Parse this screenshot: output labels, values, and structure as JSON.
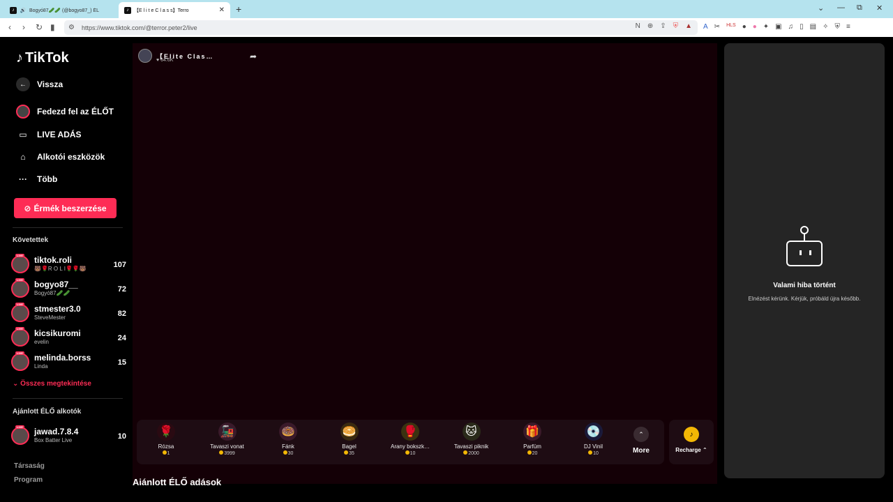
{
  "browser": {
    "tabs": [
      {
        "title": "Bogyó87🥒🥒 (@bogyo87_) ÉL",
        "active": false
      },
      {
        "title": "【E l i t e  C l a s s】Terro",
        "active": true
      }
    ],
    "url": "https://www.tiktok.com/@terror.peter2/live"
  },
  "sidebar": {
    "logo": "TikTok",
    "back": "Vissza",
    "nav": [
      {
        "label": "Fedezd fel az ÉLŐT",
        "icon": "avatar-icon"
      },
      {
        "label": "LIVE ADÁS",
        "icon": "camera-icon"
      },
      {
        "label": "Alkotói eszközök",
        "icon": "creator-tools-icon"
      },
      {
        "label": "Több",
        "icon": "more-dots-icon"
      }
    ],
    "coins_button": "Érmék beszerzése",
    "following_title": "Követettek",
    "following": [
      {
        "name": "tiktok.roli",
        "sub": "🐻🌹R O L I🌹🌹🐻",
        "count": "107"
      },
      {
        "name": "bogyo87__",
        "sub": "Bogyó87🥒🥒",
        "count": "72"
      },
      {
        "name": "stmester3.0",
        "sub": "SteveMester",
        "count": "82"
      },
      {
        "name": "kicsikuromi",
        "sub": "evelin",
        "count": "24"
      },
      {
        "name": "melinda.borss",
        "sub": "Linda",
        "count": "15"
      }
    ],
    "see_all": "Összes megtekintése",
    "recommended_title": "Ajánlott ÉLŐ alkotók",
    "recommended": [
      {
        "name": "jawad.7.8.4",
        "sub": "Box Batter Live",
        "count": "10"
      }
    ],
    "footer": [
      "Társaság",
      "Program"
    ],
    "live_badge": "LIVE"
  },
  "stream": {
    "host_name": "【Elite Clas…",
    "likes": "64.6K"
  },
  "gifts": [
    {
      "name": "Rózsa",
      "price": "1",
      "emoji": "🌹",
      "color": "#2a0a12"
    },
    {
      "name": "Tavaszi vonat",
      "price": "3999",
      "emoji": "🚂",
      "color": "#3a1a2a"
    },
    {
      "name": "Fánk",
      "price": "30",
      "emoji": "🍩",
      "color": "#3a1a2a"
    },
    {
      "name": "Bagel",
      "price": "35",
      "emoji": "🥯",
      "color": "#3a2a10"
    },
    {
      "name": "Arany bokszk…",
      "price": "10",
      "emoji": "🥊",
      "color": "#3a3210"
    },
    {
      "name": "Tavaszi piknik",
      "price": "2000",
      "emoji": "🐱",
      "color": "#2a2a1a"
    },
    {
      "name": "Parfüm",
      "price": "20",
      "emoji": "🎁",
      "color": "#3a1a2a"
    },
    {
      "name": "DJ Vinil",
      "price": "10",
      "emoji": "💿",
      "color": "#1a1a3a"
    }
  ],
  "more_label": "More",
  "recharge_label": "Recharge ⌃",
  "recommended_streams_title": "Ajánlott ÉLŐ adások",
  "chat_error": {
    "title": "Valami hiba történt",
    "subtitle": "Elnézést kérünk. Kérjük, próbáld újra később."
  }
}
